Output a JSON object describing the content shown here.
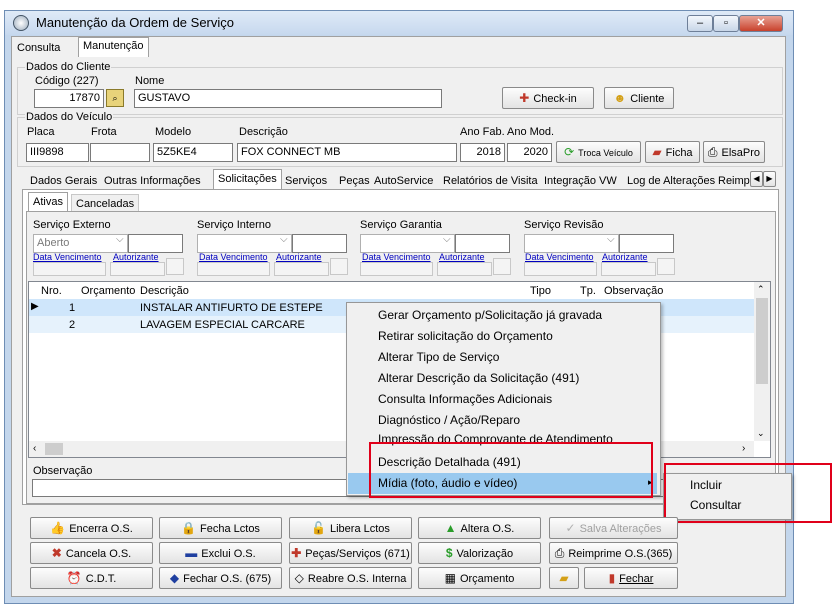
{
  "window": {
    "title": "Manutenção da Ordem de Serviço",
    "controls": [
      "–",
      "▫",
      "✕"
    ]
  },
  "top_tabs": [
    "Consulta",
    "Manutenção"
  ],
  "cliente": {
    "group_label": "Dados do Cliente",
    "codigo_label": "Código (227)",
    "codigo_value": "17870",
    "nome_label": "Nome",
    "nome_value": "GUSTAVO",
    "checkin_label": "Check-in",
    "cliente_button": "Cliente"
  },
  "veiculo": {
    "group_label": "Dados do Veículo",
    "placa_label": "Placa",
    "placa_value": "III9898",
    "frota_label": "Frota",
    "frota_value": "",
    "modelo_label": "Modelo",
    "modelo_value": "5Z5KE4",
    "descricao_label": "Descrição",
    "descricao_value": "FOX CONNECT MB",
    "anofab_label": "Ano Fab.",
    "anofab_value": "2018",
    "anomod_label": "Ano Mod.",
    "anomod_value": "2020",
    "troca_label": "Troca Veículo",
    "ficha_label": "Ficha",
    "elsapro_label": "ElsaPro"
  },
  "main_tabs": [
    "Dados Gerais",
    "Outras Informações",
    "Solicitações",
    "Serviços",
    "Peças",
    "AutoService",
    "Relatórios de Visita",
    "Integração VW",
    "Log de Alterações",
    "Reimp"
  ],
  "main_tabs_active": "Solicitações",
  "sub_tabs": [
    "Ativas",
    "Canceladas"
  ],
  "servicos": [
    {
      "label": "Serviço Externo",
      "combo": "Aberto"
    },
    {
      "label": "Serviço Interno",
      "combo": ""
    },
    {
      "label": "Serviço Garantia",
      "combo": ""
    },
    {
      "label": "Serviço Revisão",
      "combo": ""
    }
  ],
  "data_venc_label": "Data Vencimento",
  "autorizante_label": "Autorizante",
  "grid": {
    "columns": [
      "Nro.",
      "Orçamento",
      "Descrição",
      "Tipo",
      "Tp.",
      "Observação"
    ],
    "rows": [
      {
        "nro": "1",
        "orcamento": "",
        "descricao": "INSTALAR ANTIFURTO DE ESTEPE"
      },
      {
        "nro": "2",
        "orcamento": "",
        "descricao": "LAVAGEM ESPECIAL CARCARE"
      }
    ]
  },
  "observacao_label": "Observação",
  "context_menu": [
    "Gerar Orçamento p/Solicitação já gravada",
    "Retirar solicitação do Orçamento",
    "Alterar Tipo de Serviço",
    "Alterar Descrição da Solicitação (491)",
    "Consulta Informações Adicionais",
    "Diagnóstico / Ação/Reparo",
    "Impressão do Comprovante de Atendimento",
    "Descrição Detalhada (491)",
    "Mídia (foto, áudio e vídeo)"
  ],
  "submenu": [
    "Incluir",
    "Consultar"
  ],
  "buttons": {
    "encerra": "Encerra O.S.",
    "fecha_lctos": "Fecha Lctos",
    "libera_lctos": "Libera Lctos",
    "altera": "Altera O.S.",
    "salva": "Salva Alterações",
    "cancela": "Cancela O.S.",
    "exclui": "Exclui O.S.",
    "pecas": "Peças/Serviços (671)",
    "valorizacao": "Valorização",
    "reimprime": "Reimprime O.S.(365)",
    "cdt": "C.D.T.",
    "fechar_os": "Fechar O.S. (675)",
    "reabre": "Reabre O.S. Interna",
    "orcamento": "Orçamento",
    "fechar": "Fechar"
  },
  "colors": {
    "highlight": "#99c9ef",
    "annotation": "#e0001a",
    "selected_row": "#cfe6fb"
  }
}
